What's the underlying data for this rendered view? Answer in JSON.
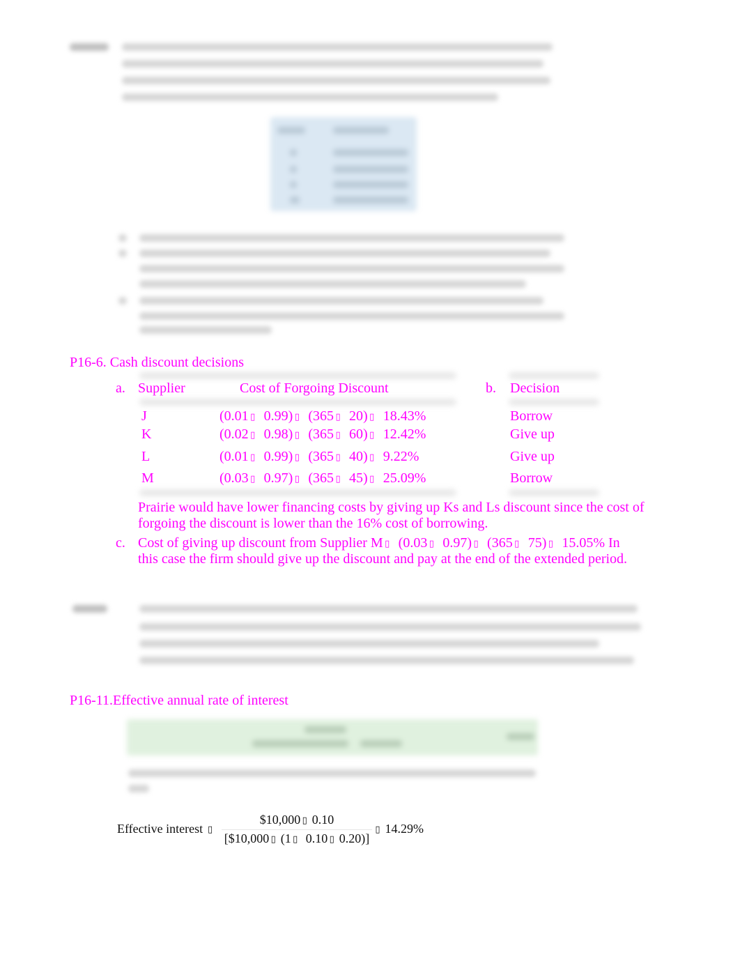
{
  "document": {
    "blurred_problem_1": {
      "label": "P16-6",
      "description": "Cash discount decisions problem statement (blurred, illegible)"
    },
    "answer_p16_6": {
      "heading": "P16-6.  Cash discount decisions",
      "part_a": {
        "marker": "a.",
        "col_supplier": "Supplier",
        "col_cost": "Cost of Forgoing Discount"
      },
      "part_b": {
        "marker": "b.",
        "col_decision": "Decision"
      },
      "rows": [
        {
          "supplier": "J",
          "a1": "0.01",
          "a2": "0.99",
          "b1": "365",
          "b2": "20",
          "cost": "18.43%",
          "decision": "Borrow"
        },
        {
          "supplier": "K",
          "a1": "0.02",
          "a2": "0.98",
          "b1": "365",
          "b2": "60",
          "cost": "12.42%",
          "decision": "Give up"
        },
        {
          "supplier": "L",
          "a1": "0.01",
          "a2": "0.99",
          "b1": "365",
          "b2": "40",
          "cost": "9.22%",
          "decision": "Give up"
        },
        {
          "supplier": "M",
          "a1": "0.03",
          "a2": "0.97",
          "b1": "365",
          "b2": "45",
          "cost": "25.09%",
          "decision": "Borrow"
        }
      ],
      "glyph": "▯",
      "explanation_line1": "Prairie would have lower financing costs by giving up Ks and Ls discount since the cost of",
      "explanation_line2": "forgoing the discount is lower than the 16% cost of borrowing.",
      "part_c": {
        "marker": "c.",
        "line1_prefix": "Cost of giving up discount from Supplier M",
        "a1": "0.03",
        "a2": "0.97",
        "b1": "365",
        "b2": "75",
        "result": "15.05% In",
        "line2": "this case the firm should give up the discount and pay at the end of the extended period."
      }
    },
    "blurred_problem_2": {
      "label": "P16-11",
      "description": "Effective annual rate problem statement (blurred, illegible)"
    },
    "answer_p16_11": {
      "heading": "P16-11.Effective annual rate of interest",
      "formula": {
        "label": "Effective interest",
        "numerator": "$10,000",
        "numerator_factor": "0.10",
        "denominator_open": "[$10,000",
        "denominator_paren": "(1",
        "denominator_a": "0.10",
        "denominator_b": "0.20)]",
        "result": "14.29%"
      }
    }
  }
}
